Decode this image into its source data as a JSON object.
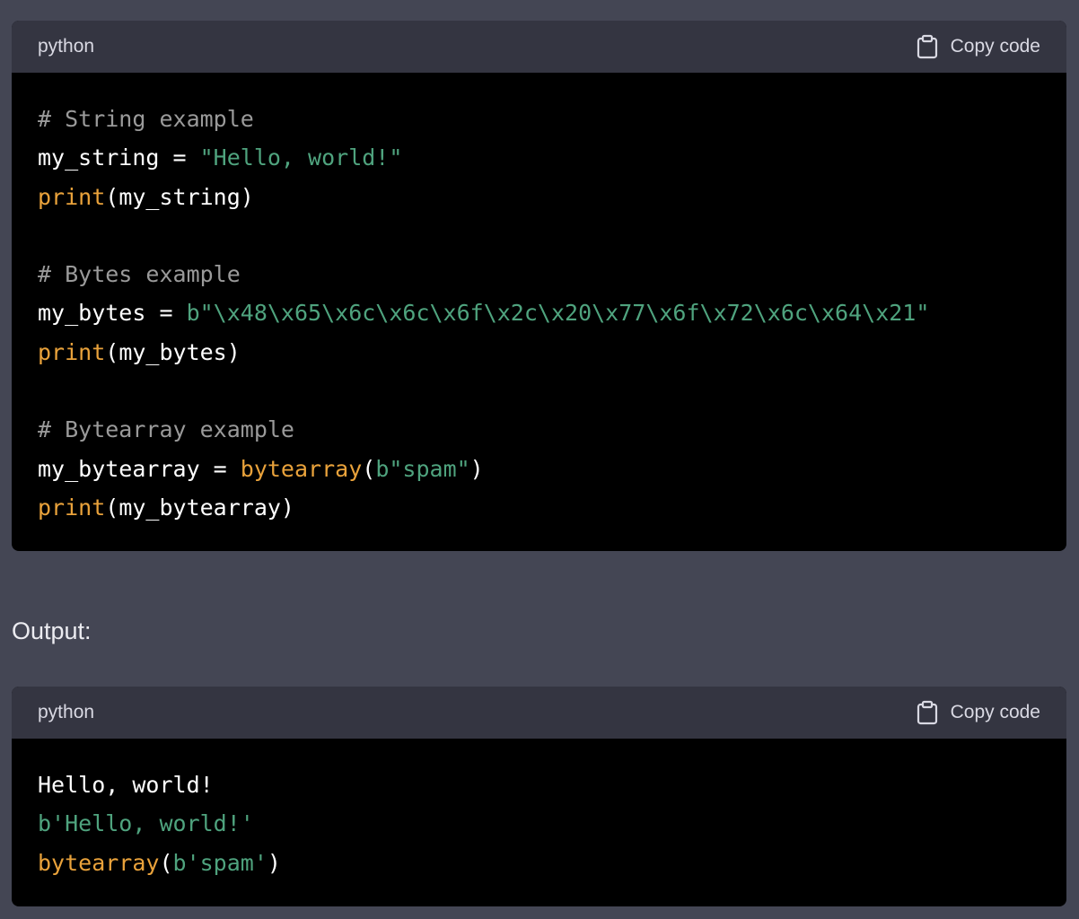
{
  "code_blocks": [
    {
      "language": "python",
      "copy_label": "Copy code",
      "lines": [
        [
          {
            "t": "comment",
            "text": "# String example"
          }
        ],
        [
          {
            "t": "plain",
            "text": "my_string = "
          },
          {
            "t": "string",
            "text": "\"Hello, world!\""
          }
        ],
        [
          {
            "t": "builtin",
            "text": "print"
          },
          {
            "t": "plain",
            "text": "(my_string)"
          }
        ],
        [],
        [
          {
            "t": "comment",
            "text": "# Bytes example"
          }
        ],
        [
          {
            "t": "plain",
            "text": "my_bytes = "
          },
          {
            "t": "string",
            "text": "b\"\\x48\\x65\\x6c\\x6c\\x6f\\x2c\\x20\\x77\\x6f\\x72\\x6c\\x64\\x21\""
          }
        ],
        [
          {
            "t": "builtin",
            "text": "print"
          },
          {
            "t": "plain",
            "text": "(my_bytes)"
          }
        ],
        [],
        [
          {
            "t": "comment",
            "text": "# Bytearray example"
          }
        ],
        [
          {
            "t": "plain",
            "text": "my_bytearray = "
          },
          {
            "t": "builtin",
            "text": "bytearray"
          },
          {
            "t": "plain",
            "text": "("
          },
          {
            "t": "string",
            "text": "b\"spam\""
          },
          {
            "t": "plain",
            "text": ")"
          }
        ],
        [
          {
            "t": "builtin",
            "text": "print"
          },
          {
            "t": "plain",
            "text": "(my_bytearray)"
          }
        ]
      ]
    },
    {
      "language": "python",
      "copy_label": "Copy code",
      "lines": [
        [
          {
            "t": "plain",
            "text": "Hello, world!"
          }
        ],
        [
          {
            "t": "string",
            "text": "b'Hello, world!'"
          }
        ],
        [
          {
            "t": "builtin",
            "text": "bytearray"
          },
          {
            "t": "plain",
            "text": "("
          },
          {
            "t": "string",
            "text": "b'spam'"
          },
          {
            "t": "plain",
            "text": ")"
          }
        ]
      ]
    }
  ],
  "output_label": "Output:",
  "colors": {
    "page_bg": "#444654",
    "header_bg": "#343541",
    "code_bg": "#000000",
    "comment": "#9a9a9a",
    "string": "#4fa37e",
    "builtin": "#e9a23b"
  },
  "icons": {
    "copy": "clipboard-icon"
  }
}
